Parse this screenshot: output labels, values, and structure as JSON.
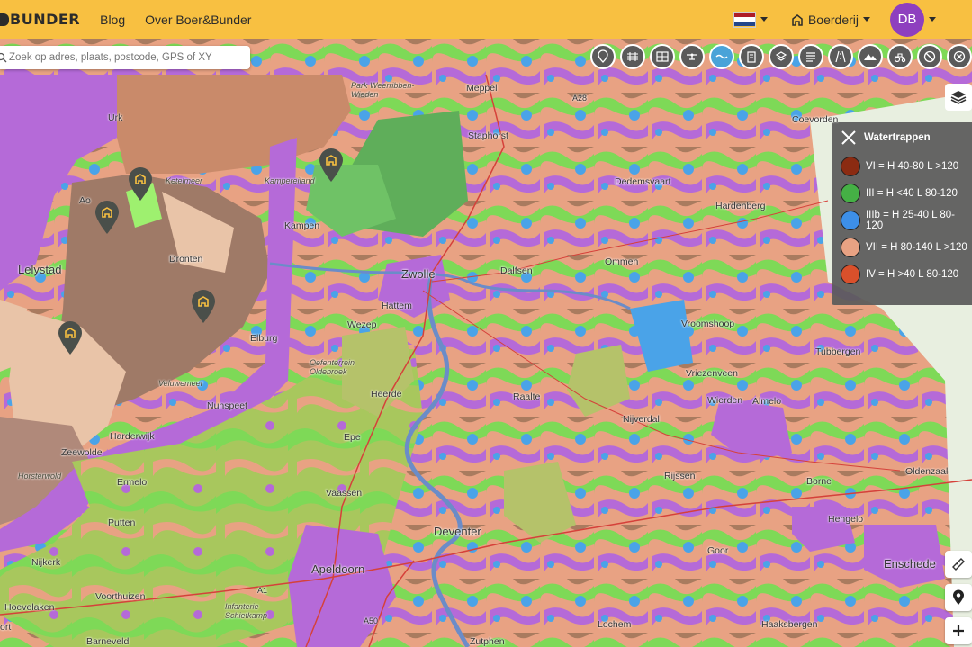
{
  "header": {
    "logo_text": "BUNDER",
    "nav": [
      "Blog",
      "Over Boer&Bunder"
    ],
    "farm_label": "Boerderij",
    "avatar_initials": "DB",
    "flag_colors": [
      "#ae1c28",
      "#ffffff",
      "#21468b"
    ]
  },
  "search": {
    "placeholder": "Zoek op adres, plaats, postcode, GPS of XY"
  },
  "toolbar": {
    "icons": [
      "map-pin-icon",
      "train-track-icon",
      "grid-icon",
      "drone-icon",
      "water-icon",
      "building-icon",
      "stack-icon",
      "list-icon",
      "road-icon",
      "terrain-icon",
      "tractor-icon",
      "no-entry-icon",
      "close-circle-icon"
    ],
    "active_index": 4
  },
  "legend": {
    "title": "Watertrappen",
    "items": [
      {
        "label": "VI = H 40-80 L >120",
        "color": "#8b2b12"
      },
      {
        "label": "III = H <40 L 80-120",
        "color": "#45b045"
      },
      {
        "label": "IIIb = H 25-40 L 80-120",
        "color": "#3d8fe8"
      },
      {
        "label": "VII = H 80-140 L >120",
        "color": "#e8a283"
      },
      {
        "label": "IV = H >40 L 80-120",
        "color": "#d9502b"
      }
    ]
  },
  "places": {
    "urk": "Urk",
    "meppel": "Meppel",
    "staphorst": "Staphorst",
    "coevorden": "Coevorden",
    "kampereiland": "Kampereiland",
    "kampen": "Kampen",
    "dedemsvaart": "Dedemsvaart",
    "hardenberg": "Hardenberg",
    "lelystad": "Lelystad",
    "dronten": "Dronten",
    "zwolle": "Zwolle",
    "dalfsen": "Dalfsen",
    "ommen": "Ommen",
    "hattem": "Hattem",
    "wezep": "Wezep",
    "vroomshoop": "Vroomshoop",
    "elburg": "Elburg",
    "tubbergen": "Tubbergen",
    "vriezenveen": "Vriezenveen",
    "heerde": "Heerde",
    "raalte": "Raalte",
    "nunspeet": "Nunspeet",
    "nijverdal": "Nijverdal",
    "wierden": "Wierden",
    "almelo": "Almelo",
    "harderwijk": "Harderwijk",
    "epe": "Epe",
    "zeewolde": "Zeewolde",
    "oldenzaal": "Oldenzaal",
    "ermelo": "Ermelo",
    "rijssen": "Rijssen",
    "borne": "Borne",
    "vaassen": "Vaassen",
    "hengelo": "Hengelo",
    "putten": "Putten",
    "deventer": "Deventer",
    "goor": "Goor",
    "nijkerk": "Nijkerk",
    "enschede": "Enschede",
    "apeldoorn": "Apeldoorn",
    "voorthuizen": "Voorthuizen",
    "hoevelaken": "Hoevelaken",
    "lochem": "Lochem",
    "haaksbergen": "Haaksbergen",
    "barneveld": "Barneveld",
    "zutphen": "Zutphen",
    "amersfoort_partial": "ort",
    "park": "Park Weerribben-\nWieden",
    "ketelmeer": "Ketelmeer",
    "oldebroek": "Oefenterrein\nOldebroek",
    "veluwemeer": "Veluwemeer",
    "horsterwold": "Horsterwold",
    "infanterie": "Infanterie\nSchietkamp",
    "emmeloord": "Emmeloord",
    "ao": "Ao"
  },
  "roads": [
    "A28",
    "A1",
    "A50"
  ]
}
